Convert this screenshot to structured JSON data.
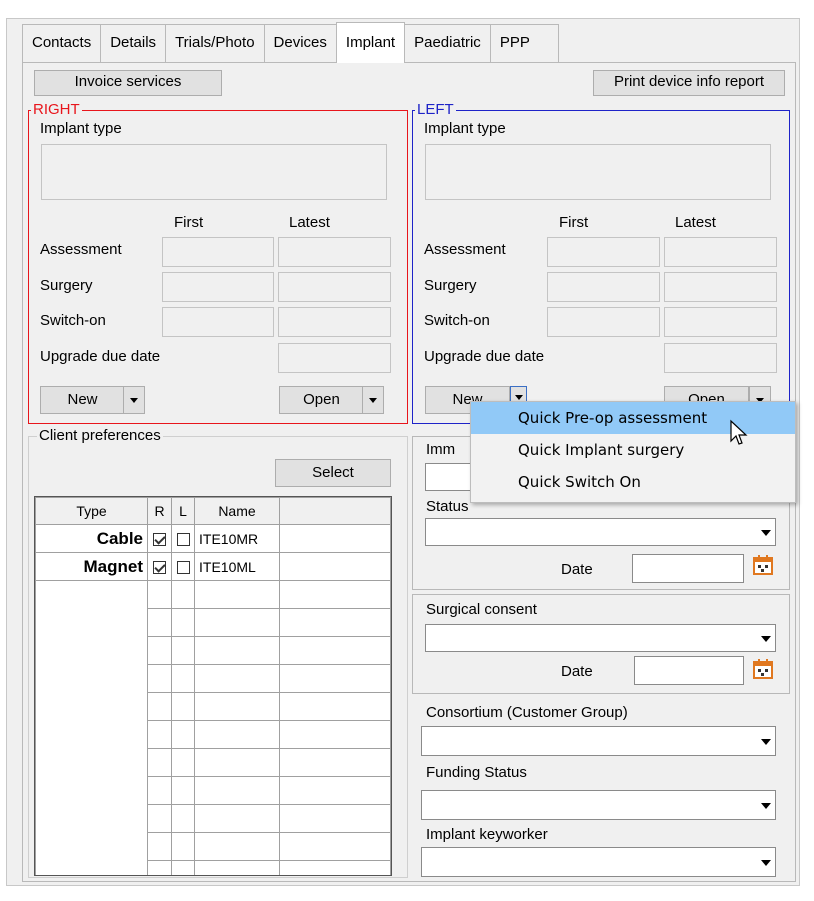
{
  "tabs": [
    "Contacts",
    "Details",
    "Trials/Photo",
    "Devices",
    "Implant",
    "Paediatric",
    "PPP"
  ],
  "active_tab": "Implant",
  "buttons": {
    "invoice": "Invoice services",
    "print": "Print device info report",
    "select": "Select"
  },
  "right": {
    "legend": "RIGHT",
    "color": "#e8151c",
    "implant_type_label": "Implant type",
    "first": "First",
    "latest": "Latest",
    "rows": [
      "Assessment",
      "Surgery",
      "Switch-on"
    ],
    "upgrade": "Upgrade due date",
    "new": "New",
    "open": "Open"
  },
  "left": {
    "legend": "LEFT",
    "color": "#1e23c8",
    "implant_type_label": "Implant type",
    "first": "First",
    "latest": "Latest",
    "rows": [
      "Assessment",
      "Surgery",
      "Switch-on"
    ],
    "upgrade": "Upgrade due date",
    "new": "New",
    "open": "Open"
  },
  "client_prefs": {
    "legend": "Client preferences",
    "columns": [
      "Type",
      "R",
      "L",
      "Name",
      ""
    ],
    "rows": [
      {
        "type": "Cable",
        "r": true,
        "l": false,
        "name": "ITE10MR"
      },
      {
        "type": "Magnet",
        "r": true,
        "l": false,
        "name": "ITE10ML"
      }
    ],
    "empty_rows": 11
  },
  "immunisation": {
    "label": "Imm",
    "status": "Status",
    "date": "Date"
  },
  "surgical_consent": {
    "label": "Surgical consent",
    "date": "Date"
  },
  "consortium": "Consortium (Customer Group)",
  "funding": "Funding Status",
  "keyworker": "Implant keyworker",
  "menu": {
    "items": [
      "Quick Pre-op assessment",
      "Quick Implant surgery",
      "Quick Switch On"
    ],
    "highlighted": 0,
    "highlight_color": "#91c9f7"
  },
  "calendar_color": "#e07820"
}
